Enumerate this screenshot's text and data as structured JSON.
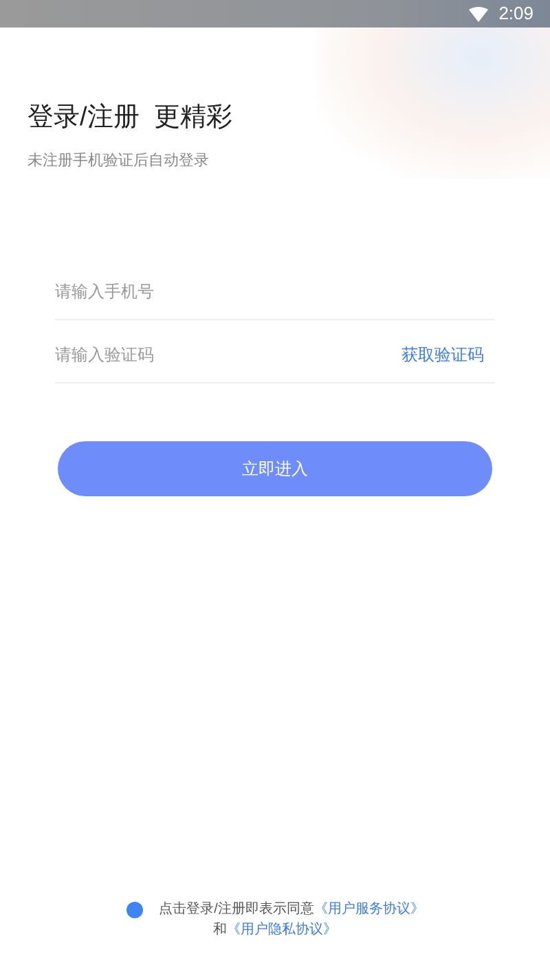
{
  "status_bar": {
    "time": "2:09"
  },
  "title": "登录/注册  更精彩",
  "subtitle": "未注册手机验证后自动登录",
  "phone_field": {
    "placeholder": "请输入手机号"
  },
  "code_field": {
    "placeholder": "请输入验证码",
    "action": "获取验证码"
  },
  "submit_button": "立即进入",
  "agreement": {
    "checked": true,
    "text": "点击登录/注册即表示同意",
    "link_1": "《用户服务协议》",
    "joiner": "和",
    "link_2": "《用户隐私协议》"
  }
}
